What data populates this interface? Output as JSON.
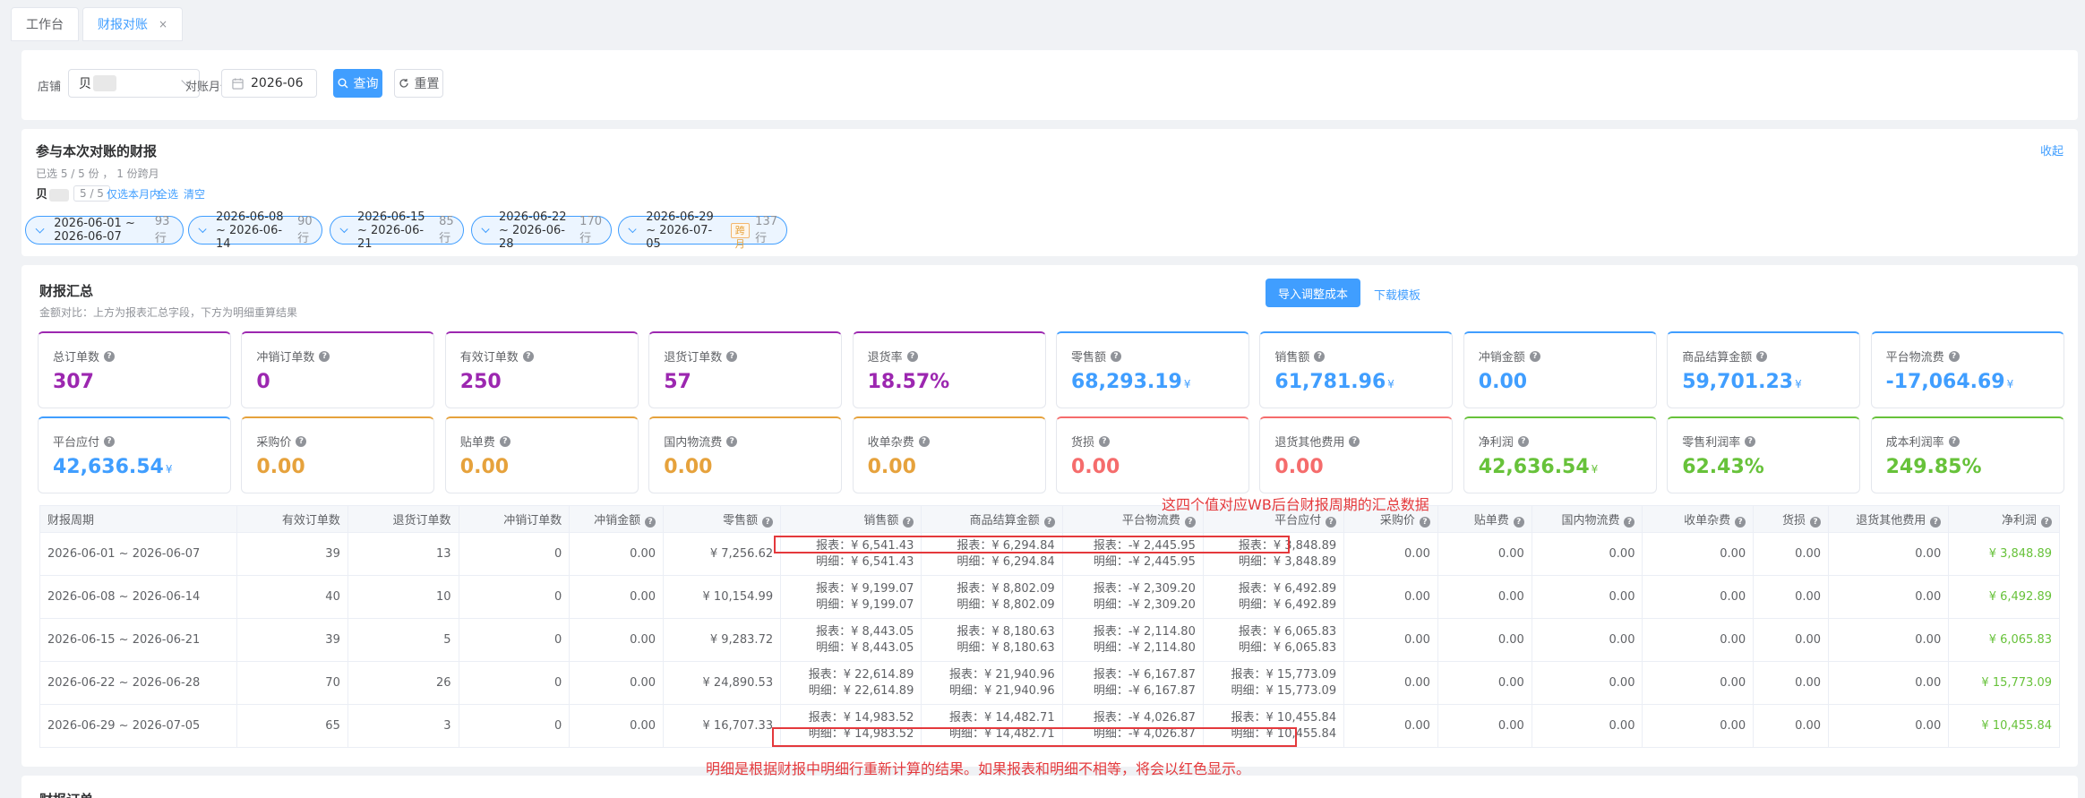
{
  "tabs": [
    {
      "label": "工作台"
    },
    {
      "label": "财报对账",
      "close": "×"
    }
  ],
  "filter": {
    "shop_label": "店铺",
    "shop_value": "贝",
    "month_label": "对账月份",
    "month_value": "2026-06",
    "search_btn": "查询",
    "reset_btn": "重置"
  },
  "reports": {
    "title": "参与本次对账的财报",
    "subtitle": "已选 5 / 5 份 ， 1 份跨月",
    "collapse": "收起",
    "shop": "贝",
    "count": "5 / 5",
    "only_month": "仅选本月内",
    "select_all": "全选",
    "clear": "清空",
    "periods": [
      {
        "range": "2026-06-01 ~ 2026-06-07",
        "rows": "93 行"
      },
      {
        "range": "2026-06-08 ~ 2026-06-14",
        "rows": "90 行"
      },
      {
        "range": "2026-06-15 ~ 2026-06-21",
        "rows": "85 行"
      },
      {
        "range": "2026-06-22 ~ 2026-06-28",
        "rows": "170 行"
      },
      {
        "range": "2026-06-29 ~ 2026-07-05",
        "rows": "137 行",
        "cross": "跨月"
      }
    ]
  },
  "summary": {
    "title": "财报汇总",
    "subtitle": "金额对比：上方为报表汇总字段，下方为明细重算结果",
    "import_btn": "导入调整成本",
    "download": "下载模板",
    "yen": "¥",
    "stats": [
      {
        "label": "总订单数",
        "value": "307",
        "color": "#9c27b0"
      },
      {
        "label": "冲销订单数",
        "value": "0",
        "color": "#9c27b0"
      },
      {
        "label": "有效订单数",
        "value": "250",
        "color": "#9c27b0"
      },
      {
        "label": "退货订单数",
        "value": "57",
        "color": "#9c27b0"
      },
      {
        "label": "退货率",
        "value": "18.57%",
        "color": "#9c27b0"
      },
      {
        "label": "零售额",
        "value": "68,293.19",
        "color": "#409eff",
        "yen": true
      },
      {
        "label": "销售额",
        "value": "61,781.96",
        "color": "#409eff",
        "yen": true
      },
      {
        "label": "冲销金额",
        "value": "0.00",
        "color": "#409eff"
      },
      {
        "label": "商品结算金额",
        "value": "59,701.23",
        "color": "#409eff",
        "yen": true
      },
      {
        "label": "平台物流费",
        "value": "-17,064.69",
        "color": "#409eff",
        "yen": true
      },
      {
        "label": "平台应付",
        "value": "42,636.54",
        "color": "#409eff",
        "yen": true
      },
      {
        "label": "采购价",
        "value": "0.00",
        "color": "#e6a23c"
      },
      {
        "label": "贴单费",
        "value": "0.00",
        "color": "#e6a23c"
      },
      {
        "label": "国内物流费",
        "value": "0.00",
        "color": "#e6a23c"
      },
      {
        "label": "收单杂费",
        "value": "0.00",
        "color": "#e6a23c"
      },
      {
        "label": "货损",
        "value": "0.00",
        "color": "#f56c6c"
      },
      {
        "label": "退货其他费用",
        "value": "0.00",
        "color": "#f56c6c"
      },
      {
        "label": "净利润",
        "value": "42,636.54",
        "color": "#67c23a",
        "yen": true
      },
      {
        "label": "零售利润率",
        "value": "62.43%",
        "color": "#67c23a"
      },
      {
        "label": "成本利润率",
        "value": "249.85%",
        "color": "#67c23a"
      }
    ],
    "table": {
      "headers": [
        "财报周期",
        "有效订单数",
        "退货订单数",
        "冲销订单数",
        "冲销金额",
        "零售额",
        "销售额",
        "商品结算金额",
        "平台物流费",
        "平台应付",
        "采购价",
        "贴单费",
        "国内物流费",
        "收单杂费",
        "货损",
        "退货其他费用",
        "净利润"
      ],
      "rows": [
        {
          "period": "2026-06-01 ~ 2026-06-07",
          "valid": "39",
          "ret": "13",
          "wo": "0",
          "woa": "0.00",
          "retail": "¥ 7,256.62",
          "sales": [
            "报表：¥ 6,541.43",
            "明细：¥ 6,541.43"
          ],
          "settle": [
            "报表：¥ 6,294.84",
            "明细：¥ 6,294.84"
          ],
          "logi": [
            "报表：-¥ 2,445.95",
            "明细：-¥ 2,445.95"
          ],
          "pay": [
            "报表：¥ 3,848.89",
            "明细：¥ 3,848.89"
          ],
          "buy": "0.00",
          "stick": "0.00",
          "dom": "0.00",
          "misc": "0.00",
          "dmg": "0.00",
          "other": "0.00",
          "net": "¥ 3,848.89"
        },
        {
          "period": "2026-06-08 ~ 2026-06-14",
          "valid": "40",
          "ret": "10",
          "wo": "0",
          "woa": "0.00",
          "retail": "¥ 10,154.99",
          "sales": [
            "报表：¥ 9,199.07",
            "明细：¥ 9,199.07"
          ],
          "settle": [
            "报表：¥ 8,802.09",
            "明细：¥ 8,802.09"
          ],
          "logi": [
            "报表：-¥ 2,309.20",
            "明细：-¥ 2,309.20"
          ],
          "pay": [
            "报表：¥ 6,492.89",
            "明细：¥ 6,492.89"
          ],
          "buy": "0.00",
          "stick": "0.00",
          "dom": "0.00",
          "misc": "0.00",
          "dmg": "0.00",
          "other": "0.00",
          "net": "¥ 6,492.89"
        },
        {
          "period": "2026-06-15 ~ 2026-06-21",
          "valid": "39",
          "ret": "5",
          "wo": "0",
          "woa": "0.00",
          "retail": "¥ 9,283.72",
          "sales": [
            "报表：¥ 8,443.05",
            "明细：¥ 8,443.05"
          ],
          "settle": [
            "报表：¥ 8,180.63",
            "明细：¥ 8,180.63"
          ],
          "logi": [
            "报表：-¥ 2,114.80",
            "明细：-¥ 2,114.80"
          ],
          "pay": [
            "报表：¥ 6,065.83",
            "明细：¥ 6,065.83"
          ],
          "buy": "0.00",
          "stick": "0.00",
          "dom": "0.00",
          "misc": "0.00",
          "dmg": "0.00",
          "other": "0.00",
          "net": "¥ 6,065.83"
        },
        {
          "period": "2026-06-22 ~ 2026-06-28",
          "valid": "70",
          "ret": "26",
          "wo": "0",
          "woa": "0.00",
          "retail": "¥ 24,890.53",
          "sales": [
            "报表：¥ 22,614.89",
            "明细：¥ 22,614.89"
          ],
          "settle": [
            "报表：¥ 21,940.96",
            "明细：¥ 21,940.96"
          ],
          "logi": [
            "报表：-¥ 6,167.87",
            "明细：-¥ 6,167.87"
          ],
          "pay": [
            "报表：¥ 15,773.09",
            "明细：¥ 15,773.09"
          ],
          "buy": "0.00",
          "stick": "0.00",
          "dom": "0.00",
          "misc": "0.00",
          "dmg": "0.00",
          "other": "0.00",
          "net": "¥ 15,773.09"
        },
        {
          "period": "2026-06-29 ~ 2026-07-05",
          "valid": "65",
          "ret": "3",
          "wo": "0",
          "woa": "0.00",
          "retail": "¥ 16,707.33",
          "sales": [
            "报表：¥ 14,983.52",
            "明细：¥ 14,983.52"
          ],
          "settle": [
            "报表：¥ 14,482.71",
            "明细：¥ 14,482.71"
          ],
          "logi": [
            "报表：-¥ 4,026.87",
            "明细：-¥ 4,026.87"
          ],
          "pay": [
            "报表：¥ 10,455.84",
            "明细：¥ 10,455.84"
          ],
          "buy": "0.00",
          "stick": "0.00",
          "dom": "0.00",
          "misc": "0.00",
          "dmg": "0.00",
          "other": "0.00",
          "net": "¥ 10,455.84"
        }
      ]
    }
  },
  "annotations": {
    "top": "这四个值对应WB后台财报周期的汇总数据",
    "bottom": "明细是根据财报中明细行重新计算的结果。如果报表和明细不相等，将会以红色显示。"
  },
  "next_section": "财报订单"
}
